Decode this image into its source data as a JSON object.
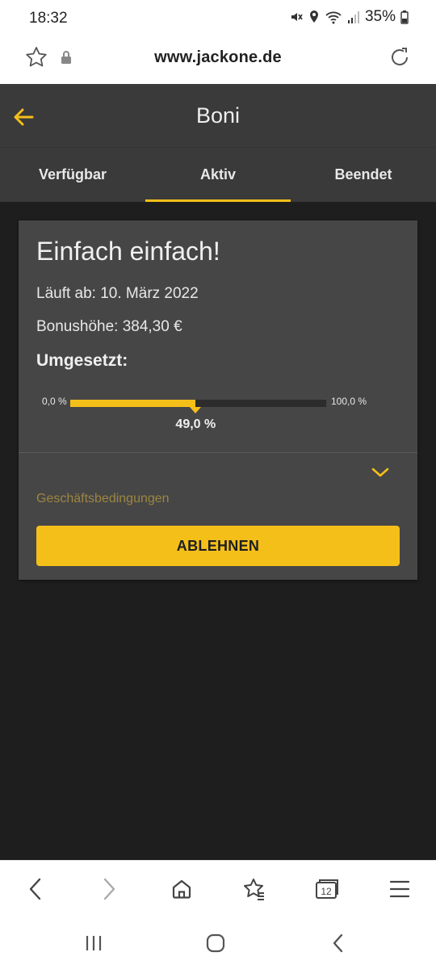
{
  "status_bar": {
    "time": "18:32",
    "battery": "35%",
    "icons": [
      "mute-icon",
      "location-icon",
      "wifi-icon",
      "signal-icon",
      "battery-icon"
    ]
  },
  "browser": {
    "url": "www.jackone.de",
    "icons": [
      "star-icon",
      "lock-icon",
      "reload-icon"
    ]
  },
  "header": {
    "title": "Boni",
    "back_icon": "arrow-left-icon"
  },
  "tabs": [
    {
      "label": "Verfügbar",
      "active": false
    },
    {
      "label": "Aktiv",
      "active": true
    },
    {
      "label": "Beendet",
      "active": false
    }
  ],
  "bonus_card": {
    "title": "Einfach einfach!",
    "expiry": "Läuft ab: 10. März 2022",
    "amount": "Bonushöhe: 384,30 €",
    "progress_label": "Umgesetzt:",
    "progress_min": "0,0 %",
    "progress_max": "100,0 %",
    "progress_value_text": "49,0 %",
    "progress_percent": 49.0,
    "terms_link": "Geschäftsbedingungen",
    "decline_button": "ABLEHNEN"
  },
  "browser_toolbar": {
    "tab_count": "12",
    "items": [
      "back-icon",
      "forward-icon",
      "home-icon",
      "bookmarks-icon",
      "tabs-icon",
      "menu-icon"
    ]
  },
  "system_nav": [
    "recents-icon",
    "home-circle-icon",
    "back-chevron-icon"
  ],
  "colors": {
    "accent": "#f5bf1a",
    "header_bg": "#3a3a3a",
    "card_bg": "#464646",
    "page_bg": "#1e1e1e",
    "terms_link": "#9c8640"
  }
}
